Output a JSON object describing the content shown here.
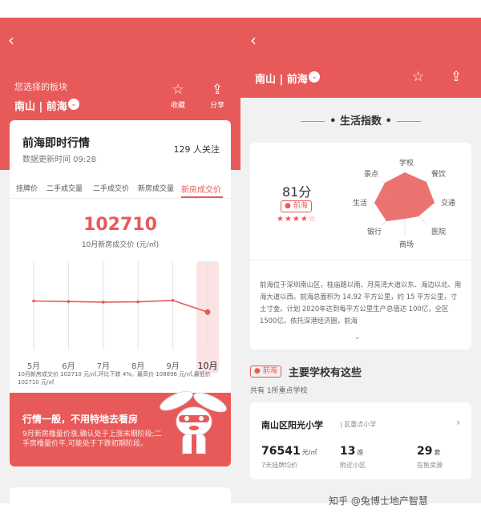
{
  "left": {
    "back_icon": "back-arrow-icon",
    "selected_label": "您选择的板块",
    "region": "南山 | 前海",
    "favorite_label": "收藏",
    "share_label": "分享",
    "card": {
      "title": "前海即时行情",
      "update_text": "数据更新时间  09:28",
      "follow_count": "129 人关注",
      "tabs": [
        "挂牌价",
        "二手成交量",
        "二手成交价",
        "新房成交量",
        "新房成交价"
      ],
      "active_tab": "新房成交价",
      "price": "102710",
      "price_desc": "10月新房成交价 (元/㎡)",
      "note": "10月新房成交价 102710 元/㎡,环比下跌 4%。最高价 108896 元/㎡,最低价 102710 元/㎡"
    },
    "promo": {
      "title": "行情一般，不用特地去看房",
      "text": "9月新房橹量价涨,确认处于上涨末期阶段;二手房橹量价平,可能处于下跌初期阶段。"
    }
  },
  "chart_data": {
    "type": "line",
    "categories": [
      "5月",
      "6月",
      "7月",
      "8月",
      "9月",
      "10月"
    ],
    "values": [
      106500,
      106300,
      106100,
      106200,
      106700,
      102710
    ],
    "highlight": "10月",
    "ylim": [
      90000,
      120000
    ],
    "grid": true
  },
  "right": {
    "region": "南山 | 前海",
    "section_title": "生活指数",
    "score": "81分",
    "location_tag": "前海",
    "stars": "★★★★☆",
    "radar_labels": [
      "学校",
      "餐饮",
      "交通",
      "医院",
      "商场",
      "银行",
      "生活",
      "景点"
    ],
    "description": "前海位于深圳南山区，桂庙路以南、月亮湾大道以东、海边以北、南海大道以西。前海总面积为 14.92 平方公里，约 15 平方公里，寸土寸金。计划 2020年达到每平方公里生产总值达 100亿，全区 1500亿。依托深港经济圈，前海",
    "school_tag": "前海",
    "school_heading": "主要学校有这些",
    "school_count": "共有 1所重点学校",
    "school": {
      "name": "南山区阳光小学",
      "level": "| 区重点小学",
      "price_value": "76541",
      "price_unit": "元/㎡",
      "price_desc": "7天挂牌均价",
      "estate_value": "13",
      "estate_unit": "座",
      "estate_desc": "附近小区",
      "listing_value": "29",
      "listing_unit": "套",
      "listing_desc": "在售房源"
    }
  },
  "watermark": "知乎 @兔博士地产智慧",
  "colors": {
    "accent": "#e85a59"
  }
}
